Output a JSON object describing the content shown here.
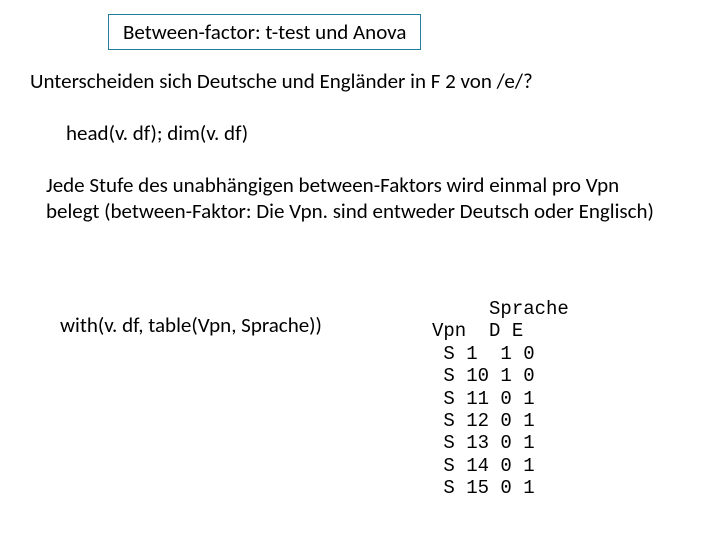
{
  "title": "Between-factor: t-test und Anova",
  "question": "Unterscheiden sich Deutsche und Engländer in F 2 von /e/?",
  "code1": "head(v. df); dim(v. df)",
  "paragraph": "Jede Stufe des unabhängigen between-Faktors wird einmal pro Vpn belegt (between-Faktor: Die Vpn. sind entweder Deutsch oder Englisch)",
  "code2": "with(v. df, table(Vpn, Sprache))",
  "table": {
    "header_label": "Sprache",
    "col_labels": [
      "Vpn",
      "D",
      "E"
    ],
    "rows": [
      {
        "vpn": "S 1",
        "D": 1,
        "E": 0
      },
      {
        "vpn": "S 10",
        "D": 1,
        "E": 0
      },
      {
        "vpn": "S 11",
        "D": 0,
        "E": 1
      },
      {
        "vpn": "S 12",
        "D": 0,
        "E": 1
      },
      {
        "vpn": "S 13",
        "D": 0,
        "E": 1
      },
      {
        "vpn": "S 14",
        "D": 0,
        "E": 1
      },
      {
        "vpn": "S 15",
        "D": 0,
        "E": 1
      }
    ]
  }
}
